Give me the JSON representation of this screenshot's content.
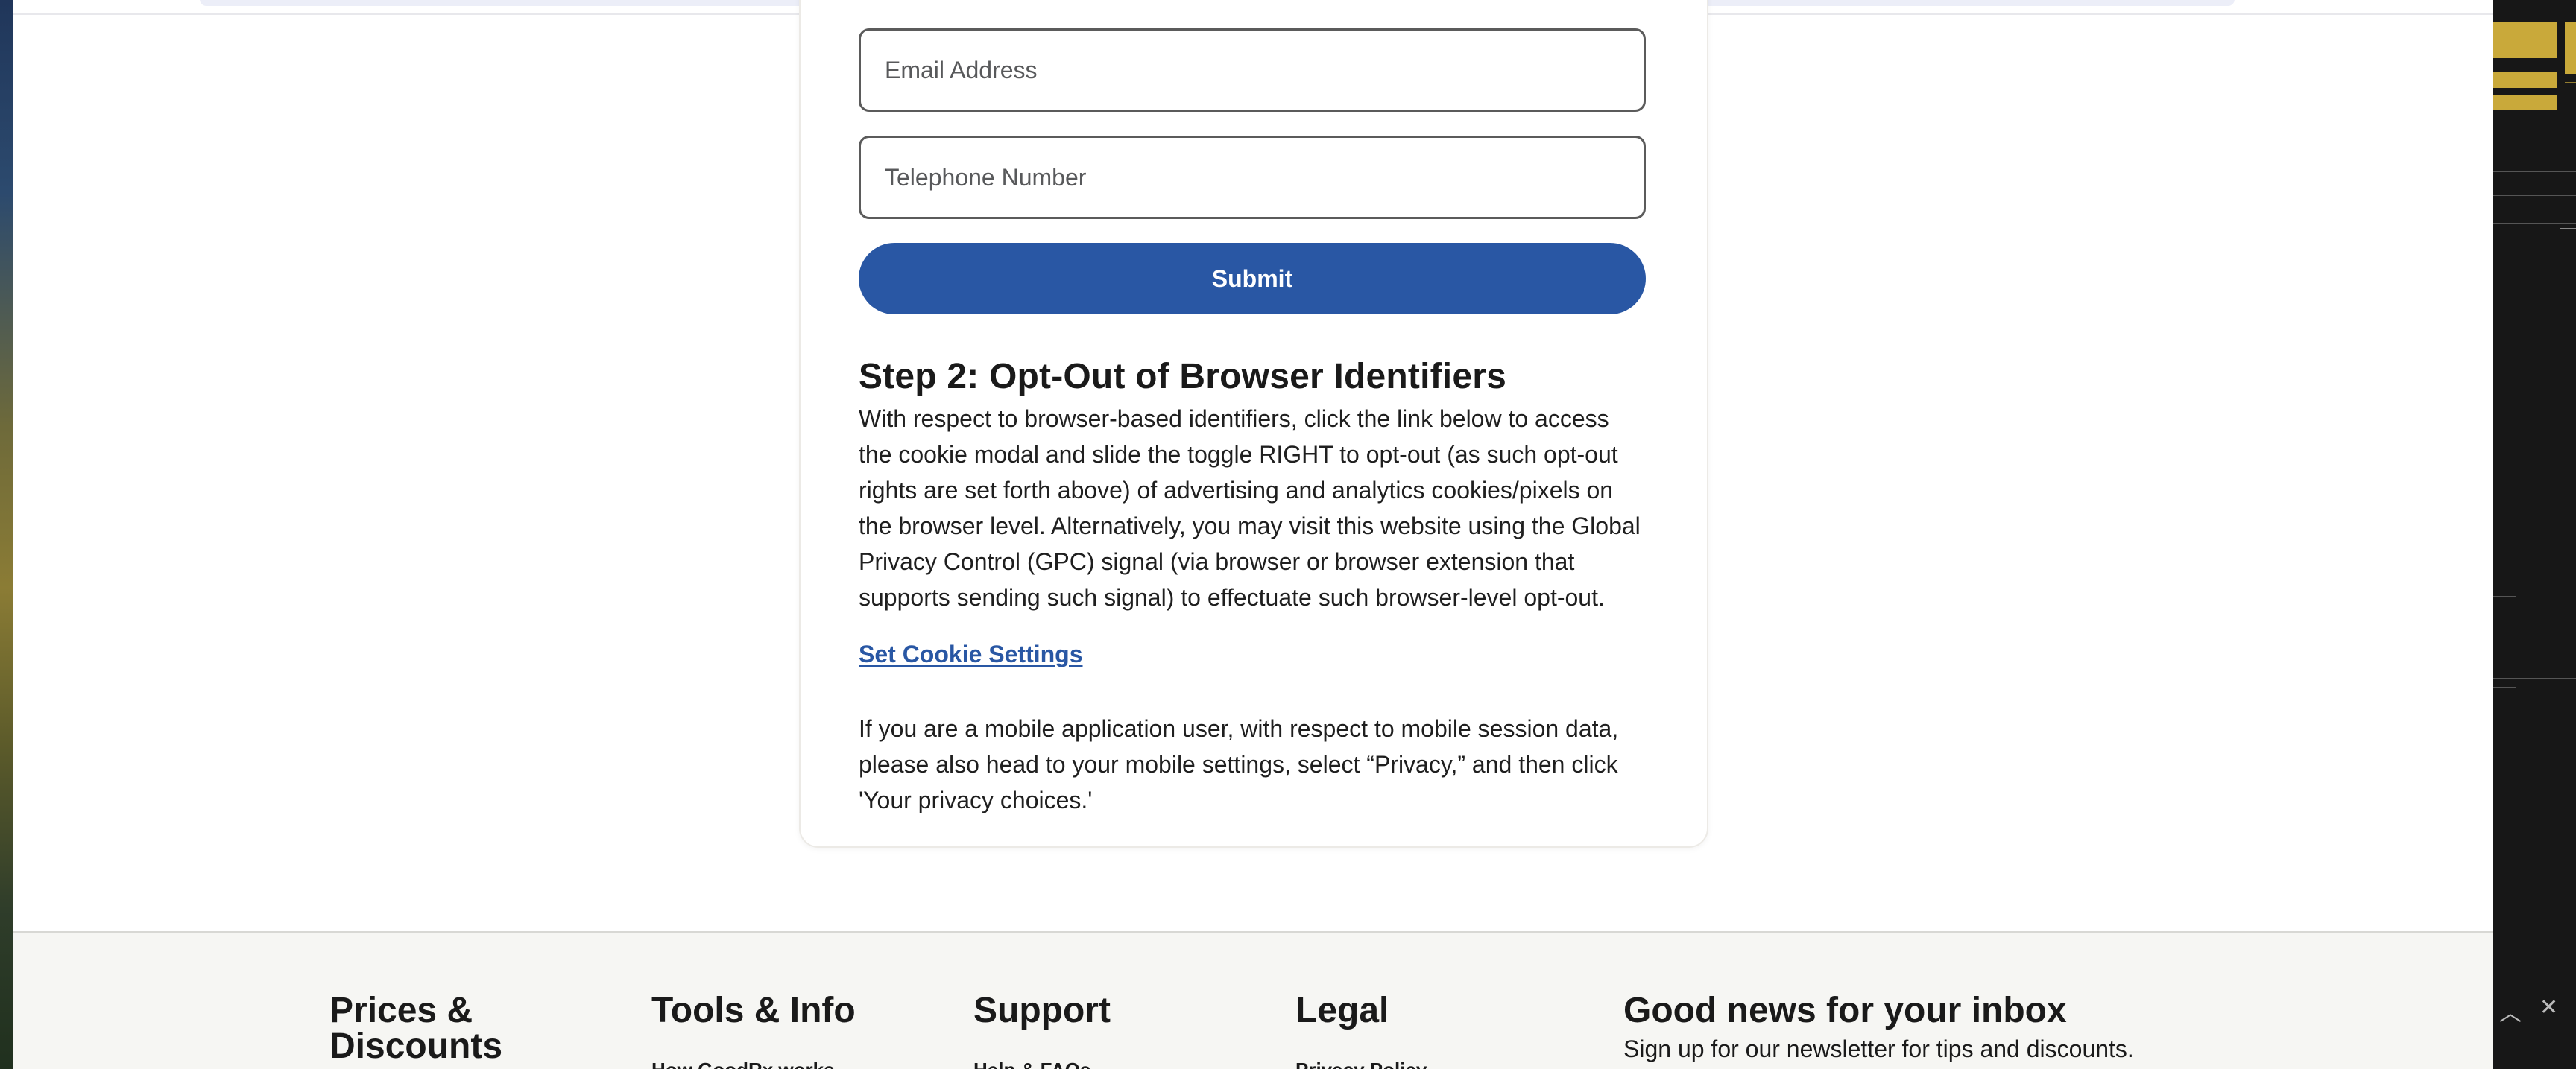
{
  "form": {
    "email_placeholder": "Email Address",
    "phone_placeholder": "Telephone Number",
    "submit_label": "Submit"
  },
  "step2": {
    "heading": "Step 2: Opt-Out of Browser Identifiers",
    "paragraph_lines": [
      "With respect to browser-based identifiers, click the link below to access",
      "the cookie modal and slide the toggle RIGHT to opt-out (as such opt-out",
      "rights are set forth above) of advertising and analytics cookies/pixels on",
      "the browser level. Alternatively, you may visit this website using the Global",
      "Privacy Control (GPC) signal (via browser or browser extension that",
      "supports sending such signal) to effectuate such browser-level opt-out."
    ],
    "cookie_link": "Set Cookie Settings",
    "mobile_lines": [
      "If you are a mobile application user, with respect to mobile session data,",
      "please also head to your mobile settings, select “Privacy,” and then click",
      "'Your privacy choices.'"
    ]
  },
  "footer": {
    "columns": [
      {
        "title_line1": "Prices &",
        "title_line2": "Discounts",
        "first_item": ""
      },
      {
        "title_line1": "Tools & Info",
        "title_line2": "",
        "first_item": "How GoodRx works"
      },
      {
        "title_line1": "Support",
        "title_line2": "",
        "first_item": "Help & FAQs"
      },
      {
        "title_line1": "Legal",
        "title_line2": "",
        "first_item": "Privacy Policy"
      }
    ],
    "newsletter": {
      "title": "Good news for your inbox",
      "subtitle": "Sign up for our newsletter for tips and discounts."
    }
  },
  "side_panel": {
    "collapse_glyph": "︿",
    "close_glyph": "✕"
  },
  "colors": {
    "primary_blue": "#2957a4",
    "footer_bg": "#f6f6f3",
    "text_dark": "#1a1a1a"
  }
}
